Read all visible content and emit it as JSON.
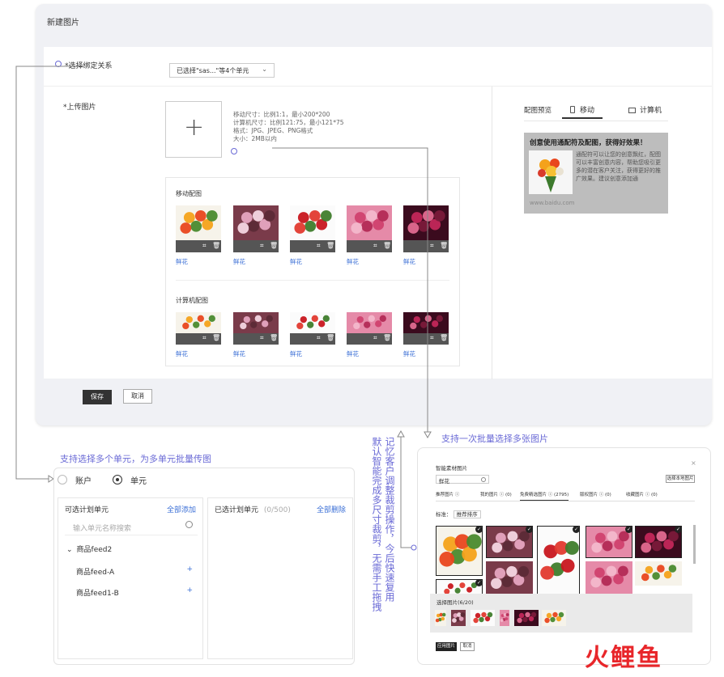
{
  "card": {
    "title": "新建图片",
    "bind_label": "*选择绑定关系",
    "bind_value": "已选择\"sas...\"等4个单元",
    "upload_label": "*上传图片",
    "hints": [
      "移动尺寸：比例1:1，最小200*200",
      "计算机尺寸：比例121:75，最小121*75",
      "格式：JPG、JPEG、PNG格式",
      "大小：2MB以内"
    ],
    "mobile_section": "移动配图",
    "pc_section": "计算机配图",
    "flower_label": "鲜花",
    "save": "保存",
    "cancel": "取消",
    "preview_label": "配图预览",
    "tab_mobile": "移动",
    "tab_pc": "计算机",
    "ad_title": "创意使用通配符及配图，获得好效果！",
    "ad_text": "通配符可以让您的创意飘红，配图可以丰富创意内容，帮助您吸引更多的潜在客户关注，获得更好的推广效果。建议创意添加通",
    "ad_url": "www.baidu.com"
  },
  "annotations": {
    "left": "支持选择多个单元，为多单元批量传图",
    "right": "支持一次批量选择多张图片",
    "col1": "记忆客户调整裁剪操作，今后快速复用",
    "col2": "默认智能完成多尺寸裁剪，无需手工拖拽"
  },
  "left_panel": {
    "account": "账户",
    "unit": "单元",
    "available_title": "可选计划单元",
    "add_all": "全部添加",
    "selected_title": "已选计划单元",
    "selected_count": "(0/500)",
    "delete_all": "全部删除",
    "search_placeholder": "输入单元名称搜索",
    "group": "商品feed2",
    "items": [
      "商品feed-A",
      "商品feed1-B"
    ]
  },
  "right_panel": {
    "title": "智能素材图片",
    "close": "×",
    "search_value": "鲜花",
    "upload_btn": "选择本地图片",
    "tabs": [
      "推荐图片 ⓘ",
      "我的图片 ⓘ (0)",
      "免费精选图片 ⓘ (2795)",
      "版权图片 ⓘ (0)",
      "收藏图片 ⓘ (0)"
    ],
    "filter": "标准：",
    "filter_value": "推荐排序",
    "selected_label": "选择图片(6/20)",
    "ok": "应用图片",
    "cancel": "取消"
  },
  "colors": {
    "accent": "#6a6ad6",
    "link": "#3b6fd6",
    "logo_red": "#e8262a"
  },
  "logo": "火鲤鱼"
}
